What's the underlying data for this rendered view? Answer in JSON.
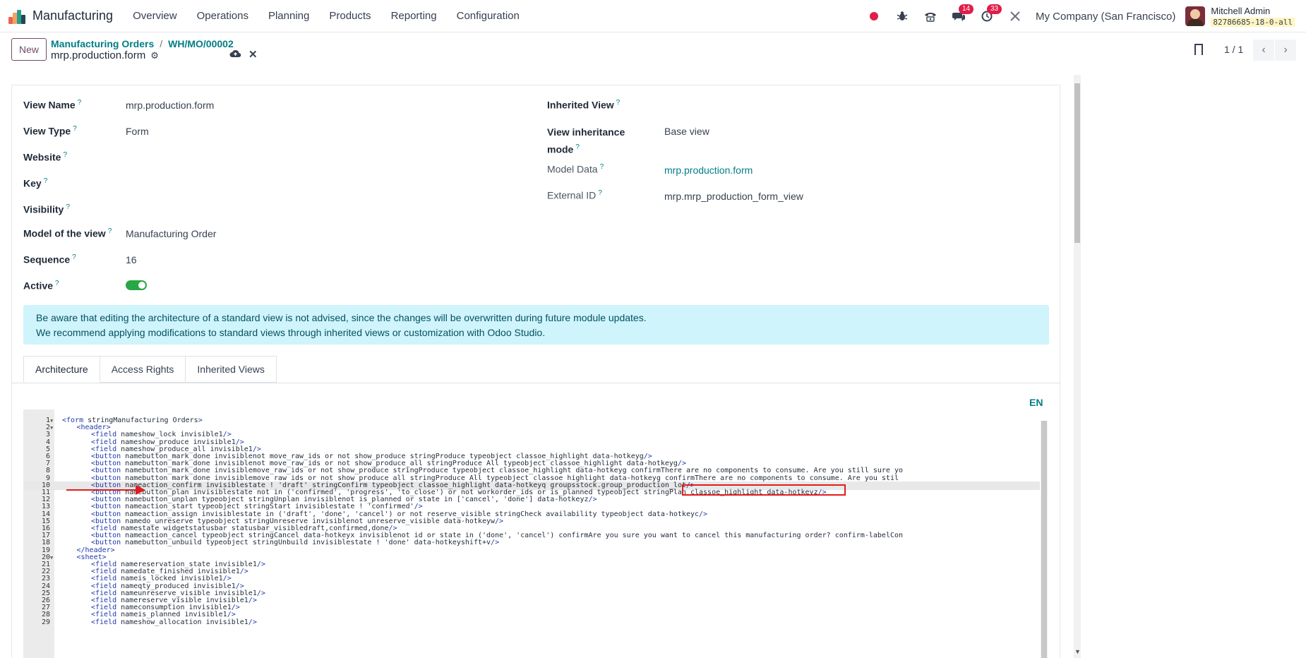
{
  "app": {
    "name": "Manufacturing"
  },
  "menu": [
    "Overview",
    "Operations",
    "Planning",
    "Products",
    "Reporting",
    "Configuration"
  ],
  "systray": {
    "messages_count": "14",
    "activities_count": "33",
    "company": "My Company (San Francisco)",
    "user_name": "Mitchell Admin",
    "db_name": "82786685-18-0-all"
  },
  "control": {
    "new_label": "New",
    "breadcrumb": [
      "Manufacturing Orders",
      "WH/MO/00002"
    ],
    "record_name": "mrp.production.form",
    "pager": "1 / 1"
  },
  "form": {
    "left": [
      {
        "label": "View Name",
        "value": "mrp.production.form"
      },
      {
        "label": "View Type",
        "value": "Form"
      },
      {
        "label": "Website",
        "value": ""
      },
      {
        "label": "Key",
        "value": ""
      },
      {
        "label": "Visibility",
        "value": ""
      },
      {
        "label": "Model of the view",
        "value": "Manufacturing Order"
      },
      {
        "label": "Sequence",
        "value": "16"
      },
      {
        "label": "Active",
        "value": ""
      }
    ],
    "right": [
      {
        "label": "Inherited View",
        "value": ""
      },
      {
        "label": "View inheritance",
        "label2": "mode",
        "value": "Base view"
      },
      {
        "label": "Model Data",
        "value": "mrp.production.form"
      },
      {
        "label": "External ID",
        "value": "mrp.mrp_production_form_view"
      }
    ],
    "active": true,
    "help_mark": "?"
  },
  "alert": {
    "line1": "Be aware that editing the architecture of a standard view is not advised, since the changes will be overwritten during future module updates.",
    "line2": "We recommend applying modifications to standard views through inherited views or customization with Odoo Studio."
  },
  "tabs": [
    "Architecture",
    "Access Rights",
    "Inherited Views"
  ],
  "lang": "EN",
  "code_lines": [
    {
      "n": "1",
      "fold": true,
      "indent": 0,
      "text": "<form string=\"Manufacturing Orders\">"
    },
    {
      "n": "2",
      "fold": true,
      "indent": 1,
      "text": "<header>"
    },
    {
      "n": "3",
      "indent": 2,
      "text": "<field name=\"show_lock\" invisible=\"1\"/>"
    },
    {
      "n": "4",
      "indent": 2,
      "text": "<field name=\"show_produce\" invisible=\"1\"/>"
    },
    {
      "n": "5",
      "indent": 2,
      "text": "<field name=\"show_produce_all\" invisible=\"1\"/>"
    },
    {
      "n": "6",
      "indent": 2,
      "text": "<button name=\"button_mark_done\" invisible=\"not move_raw_ids or not show_produce\" string=\"Produce\" type=\"object\" class=\"oe_highlight\" data-hotkey=\"g\"/>"
    },
    {
      "n": "7",
      "indent": 2,
      "text": "<button name=\"button_mark_done\" invisible=\"not move_raw_ids or not show_produce_all\" string=\"Produce All\" type=\"object\" class=\"oe_highlight\" data-hotkey=\"g\"/>"
    },
    {
      "n": "8",
      "indent": 2,
      "text": "<button name=\"button_mark_done\" invisible=\"move_raw_ids or not show_produce\" string=\"Produce\" type=\"object\" class=\"oe_highlight\" data-hotkey=\"g\" confirm=\"There are no components to consume. Are you still sure yo"
    },
    {
      "n": "9",
      "indent": 2,
      "text": "<button name=\"button_mark_done\" invisible=\"move_raw_ids or not show_produce_all\" string=\"Produce All\" type=\"object\" class=\"oe_highlight\" data-hotkey=\"g\" confirm=\"There are no components to consume. Are you stil"
    },
    {
      "n": "10",
      "indent": 2,
      "active": true,
      "text": "<button name=\"action_confirm\" invisible=\"state != 'draft'\" string=\"Confirm\" type=\"object\" class=\"oe_highlight\" data-hotkey=\"q\" groups=\"stock.group_production_lot\"/>"
    },
    {
      "n": "11",
      "indent": 2,
      "text": "<button name=\"button_plan\" invisible=\"state not in ('confirmed', 'progress', 'to_close') or not workorder_ids or is_planned\" type=\"object\" string=\"Plan\" class=\"oe_highlight\" data-hotkey=\"z\"/>"
    },
    {
      "n": "12",
      "indent": 2,
      "text": "<button name=\"button_unplan\" type=\"object\" string=\"Unplan\" invisible=\"not is_planned or state in ['cancel', 'done']\" data-hotkey=\"z\"/>"
    },
    {
      "n": "13",
      "indent": 2,
      "text": "<button name=\"action_start\" type=\"object\" string=\"Start\" invisible=\"state != 'confirmed'\"/>"
    },
    {
      "n": "14",
      "indent": 2,
      "text": "<button name=\"action_assign\" invisible=\"state in ('draft', 'done', 'cancel') or not reserve_visible\" string=\"Check availability\" type=\"object\" data-hotkey=\"c\"/>"
    },
    {
      "n": "15",
      "indent": 2,
      "text": "<button name=\"do_unreserve\" type=\"object\" string=\"Unreserve\" invisible=\"not unreserve_visible\" data-hotkey=\"w\"/>"
    },
    {
      "n": "16",
      "indent": 2,
      "text": "<field name=\"state\" widget=\"statusbar\" statusbar_visible=\"draft,confirmed,done\"/>"
    },
    {
      "n": "17",
      "indent": 2,
      "text": "<button name=\"action_cancel\" type=\"object\" string=\"Cancel\" data-hotkey=\"x\" invisible=\"not id or state in ('done', 'cancel')\" confirm=\"Are you sure you want to cancel this manufacturing order?\" confirm-label=\"Con"
    },
    {
      "n": "18",
      "indent": 2,
      "text": "<button name=\"button_unbuild\" type=\"object\" string=\"Unbuild\" invisible=\"state != 'done'\" data-hotkey=\"shift+v\"/>"
    },
    {
      "n": "19",
      "indent": 1,
      "text": "</header>"
    },
    {
      "n": "20",
      "fold": true,
      "indent": 1,
      "text": "<sheet>"
    },
    {
      "n": "21",
      "indent": 2,
      "text": "<field name=\"reservation_state\" invisible=\"1\"/>"
    },
    {
      "n": "22",
      "indent": 2,
      "text": "<field name=\"date_finished\" invisible=\"1\"/>"
    },
    {
      "n": "23",
      "indent": 2,
      "text": "<field name=\"is_locked\" invisible=\"1\"/>"
    },
    {
      "n": "24",
      "indent": 2,
      "text": "<field name=\"qty_produced\" invisible=\"1\"/>"
    },
    {
      "n": "25",
      "indent": 2,
      "text": "<field name=\"unreserve_visible\" invisible=\"1\"/>"
    },
    {
      "n": "26",
      "indent": 2,
      "text": "<field name=\"reserve_visible\" invisible=\"1\"/>"
    },
    {
      "n": "27",
      "indent": 2,
      "text": "<field name=\"consumption\" invisible=\"1\"/>"
    },
    {
      "n": "28",
      "indent": 2,
      "text": "<field name=\"is_planned\" invisible=\"1\"/>"
    },
    {
      "n": "29",
      "indent": 2,
      "text": "<field name=\"show_allocation\" invisible=\"1\"/>"
    }
  ],
  "colors": {
    "accent": "#017e84",
    "brand": "#714b67",
    "highlight": "#e11d1d"
  }
}
